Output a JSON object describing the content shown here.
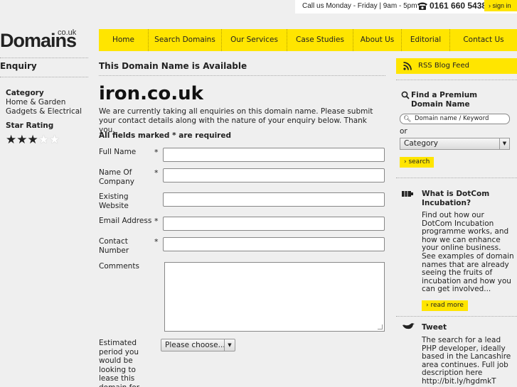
{
  "topbar": {
    "hours": "Call us Monday - Friday | 9am - 5pm",
    "phone": "0161 660 5438",
    "signin": "› sign in"
  },
  "logo": {
    "word": "Domains",
    "tld": "co.uk"
  },
  "nav": [
    "Home",
    "Search Domains",
    "Our Services",
    "Case Studies",
    "About Us",
    "Editorial",
    "Contact Us"
  ],
  "left": {
    "title": "Enquiry",
    "category_label": "Category",
    "categories": [
      "Home & Garden",
      "Gadgets & Electrical"
    ],
    "star_label": "Star Rating",
    "rating": 3,
    "rating_max": 5
  },
  "main": {
    "heading": "This Domain Name is Available",
    "domain": "iron.co.uk",
    "intro": "We are currently taking all enquiries on this domain name. Please submit your contact details along with the nature of your enquiry below. Thank you.",
    "required_note": "All fields marked * are required",
    "fields": [
      {
        "label": "Full Name",
        "required": "*",
        "value": ""
      },
      {
        "label": "Name Of Company",
        "required": "*",
        "value": ""
      },
      {
        "label": "Existing Website",
        "required": "",
        "value": ""
      },
      {
        "label": "Email Address",
        "required": "*",
        "value": ""
      },
      {
        "label": "Contact Number",
        "required": "*",
        "value": ""
      }
    ],
    "comments_label": "Comments",
    "lease_label": "Estimated period you would be looking to lease this domain for",
    "lease_select": "Please choose..."
  },
  "sidebar": {
    "rss": "RSS Blog Feed",
    "premium_title": "Find a Premium Domain Name",
    "search_placeholder": "Domain name / Keyword",
    "or": "or",
    "category_select": "Category",
    "search_button": "› search",
    "dotcom_title": "What is DotCom Incubation?",
    "dotcom_text": "Find out how our DotCom Incubation programme works, and how we can enhance your online business. See examples of domain names that are already seeing the fruits of incubation and how you can get involved...",
    "read_more": "› read more",
    "tweet_title": "Tweet",
    "tweet_text": "The search for a lead PHP developer, ideally based in the Lancashire area continues. Full job description here http://bit.ly/hgdmkT"
  },
  "colors": {
    "accent": "#ffe500",
    "background": "#efefef"
  }
}
